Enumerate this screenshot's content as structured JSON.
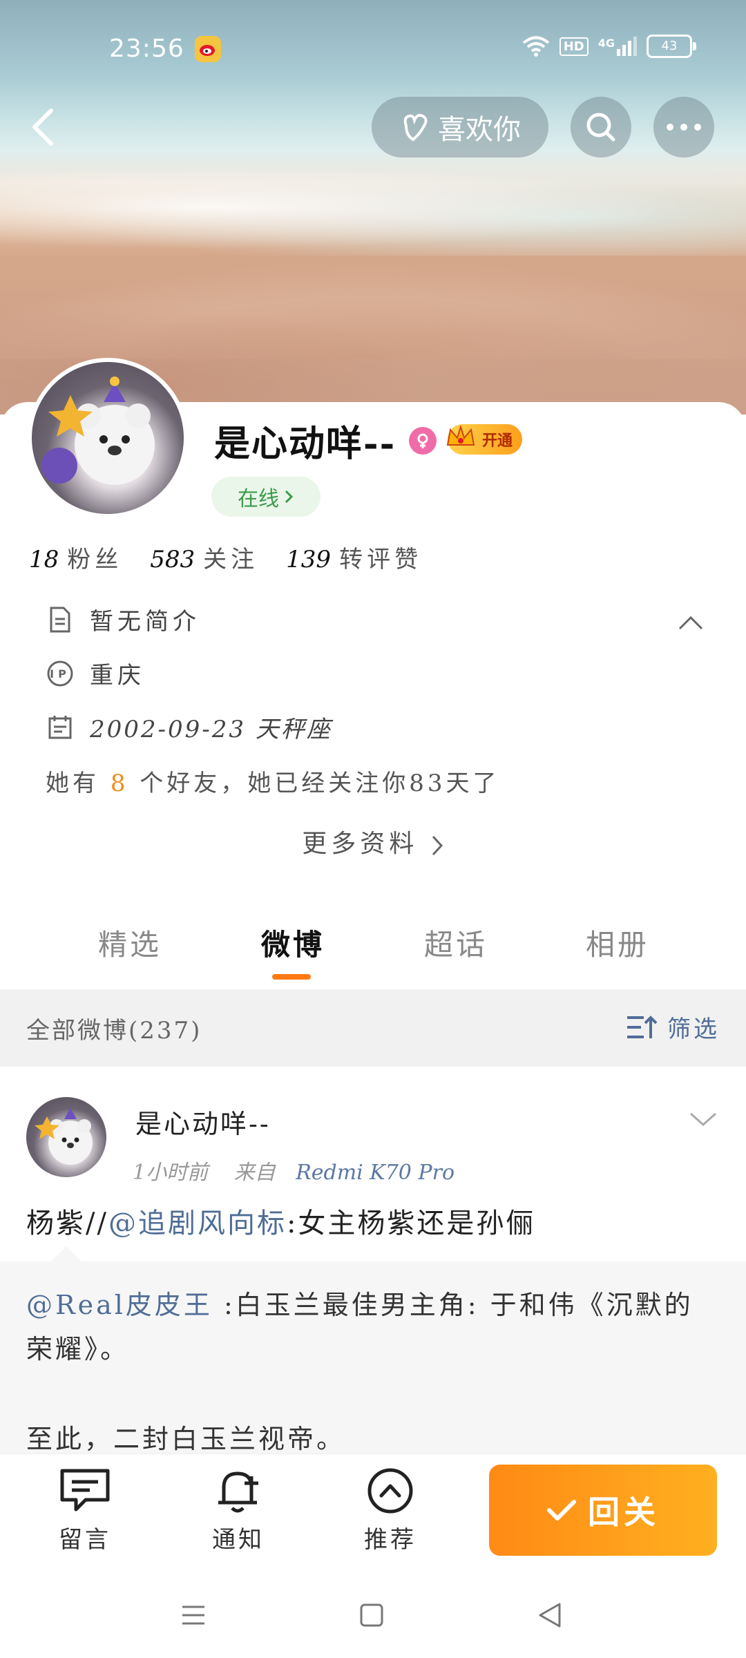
{
  "status_bar": {
    "time": "23:56",
    "hd": "HD",
    "network": "4G",
    "battery": "43"
  },
  "top_bar": {
    "like_label": "喜欢你"
  },
  "profile": {
    "name": "是心动咩--",
    "vip_label": "开通",
    "online_label": "在线",
    "stats": [
      {
        "value": "18",
        "label": "粉丝"
      },
      {
        "value": "583",
        "label": "关注"
      },
      {
        "value": "139",
        "label": "转评赞"
      }
    ],
    "bio": "暂无简介",
    "ip_location": "重庆",
    "birthday": "2002-09-23 天秤座",
    "friends_prefix": "她有",
    "friends_count": "8",
    "friends_suffix": "个好友，她已经关注你83天了",
    "more_label": "更多资料"
  },
  "tabs": [
    {
      "label": "精选"
    },
    {
      "label": "微博"
    },
    {
      "label": "超话"
    },
    {
      "label": "相册"
    }
  ],
  "active_tab": "微博",
  "feed_header": {
    "all_label": "全部微博(237)",
    "filter_label": "筛选"
  },
  "post": {
    "author": "是心动咩--",
    "time": "1小时前",
    "source_prefix": "来自",
    "source": "Redmi K70 Pro",
    "text_prefix": "杨紫//",
    "text_mention": "@追剧风向标",
    "text_suffix": ":女主杨紫还是孙俪",
    "repost_mention": "@Real皮皮王",
    "repost_line1": " :白玉兰最佳男主角: 于和伟《沉默的",
    "repost_line2": "荣耀》。",
    "repost_line3": "至此，二封白玉兰视帝。"
  },
  "action_bar": {
    "message": "留言",
    "notify": "通知",
    "recommend": "推荐",
    "follow_back": "回关"
  },
  "colors": {
    "accent": "#ff8a15",
    "link": "#4f6d96",
    "online_green": "#3a9b4a"
  }
}
